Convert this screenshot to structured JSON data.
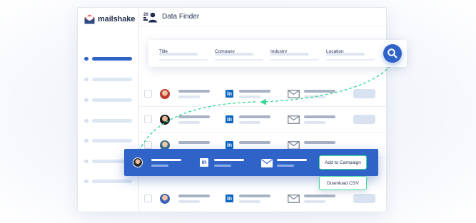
{
  "app": {
    "brand": "mailshake",
    "page_title": "Data Finder"
  },
  "sidebar": {
    "items": [
      {
        "active": true
      },
      {
        "active": false
      },
      {
        "active": false
      },
      {
        "active": false
      },
      {
        "active": false
      },
      {
        "active": false
      },
      {
        "active": false
      }
    ]
  },
  "filters": {
    "title_label": "Title",
    "company_label": "Company",
    "industry_label": "Industry",
    "location_label": "Location"
  },
  "actions": {
    "add_to_campaign": "Add to Campaign",
    "download_csv": "Download CSV"
  },
  "colors": {
    "primary": "#2f63c8",
    "accent_green": "#3fd89a",
    "linkedin": "#0a66c2"
  },
  "icons": [
    "mailshake-logo-icon",
    "data-finder-icon",
    "search-icon",
    "linkedin-icon",
    "mail-icon",
    "avatar"
  ]
}
